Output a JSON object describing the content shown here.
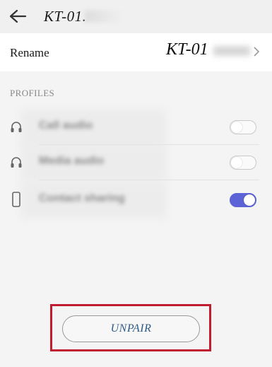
{
  "header": {
    "title": "KT-01."
  },
  "rename": {
    "label": "Rename",
    "value": "KT-01"
  },
  "profiles": {
    "section_title": "PROFILES",
    "items": [
      {
        "label": "Call audio",
        "icon": "headset-icon",
        "enabled": false
      },
      {
        "label": "Media audio",
        "icon": "headphone-icon",
        "enabled": false
      },
      {
        "label": "Contact sharing",
        "icon": "phone-icon",
        "enabled": true
      }
    ]
  },
  "unpair": {
    "label": "UNPAIR"
  },
  "colors": {
    "toggle_on": "#5b63d6",
    "highlight": "#c01d2e",
    "button_text": "#2e5b86"
  }
}
